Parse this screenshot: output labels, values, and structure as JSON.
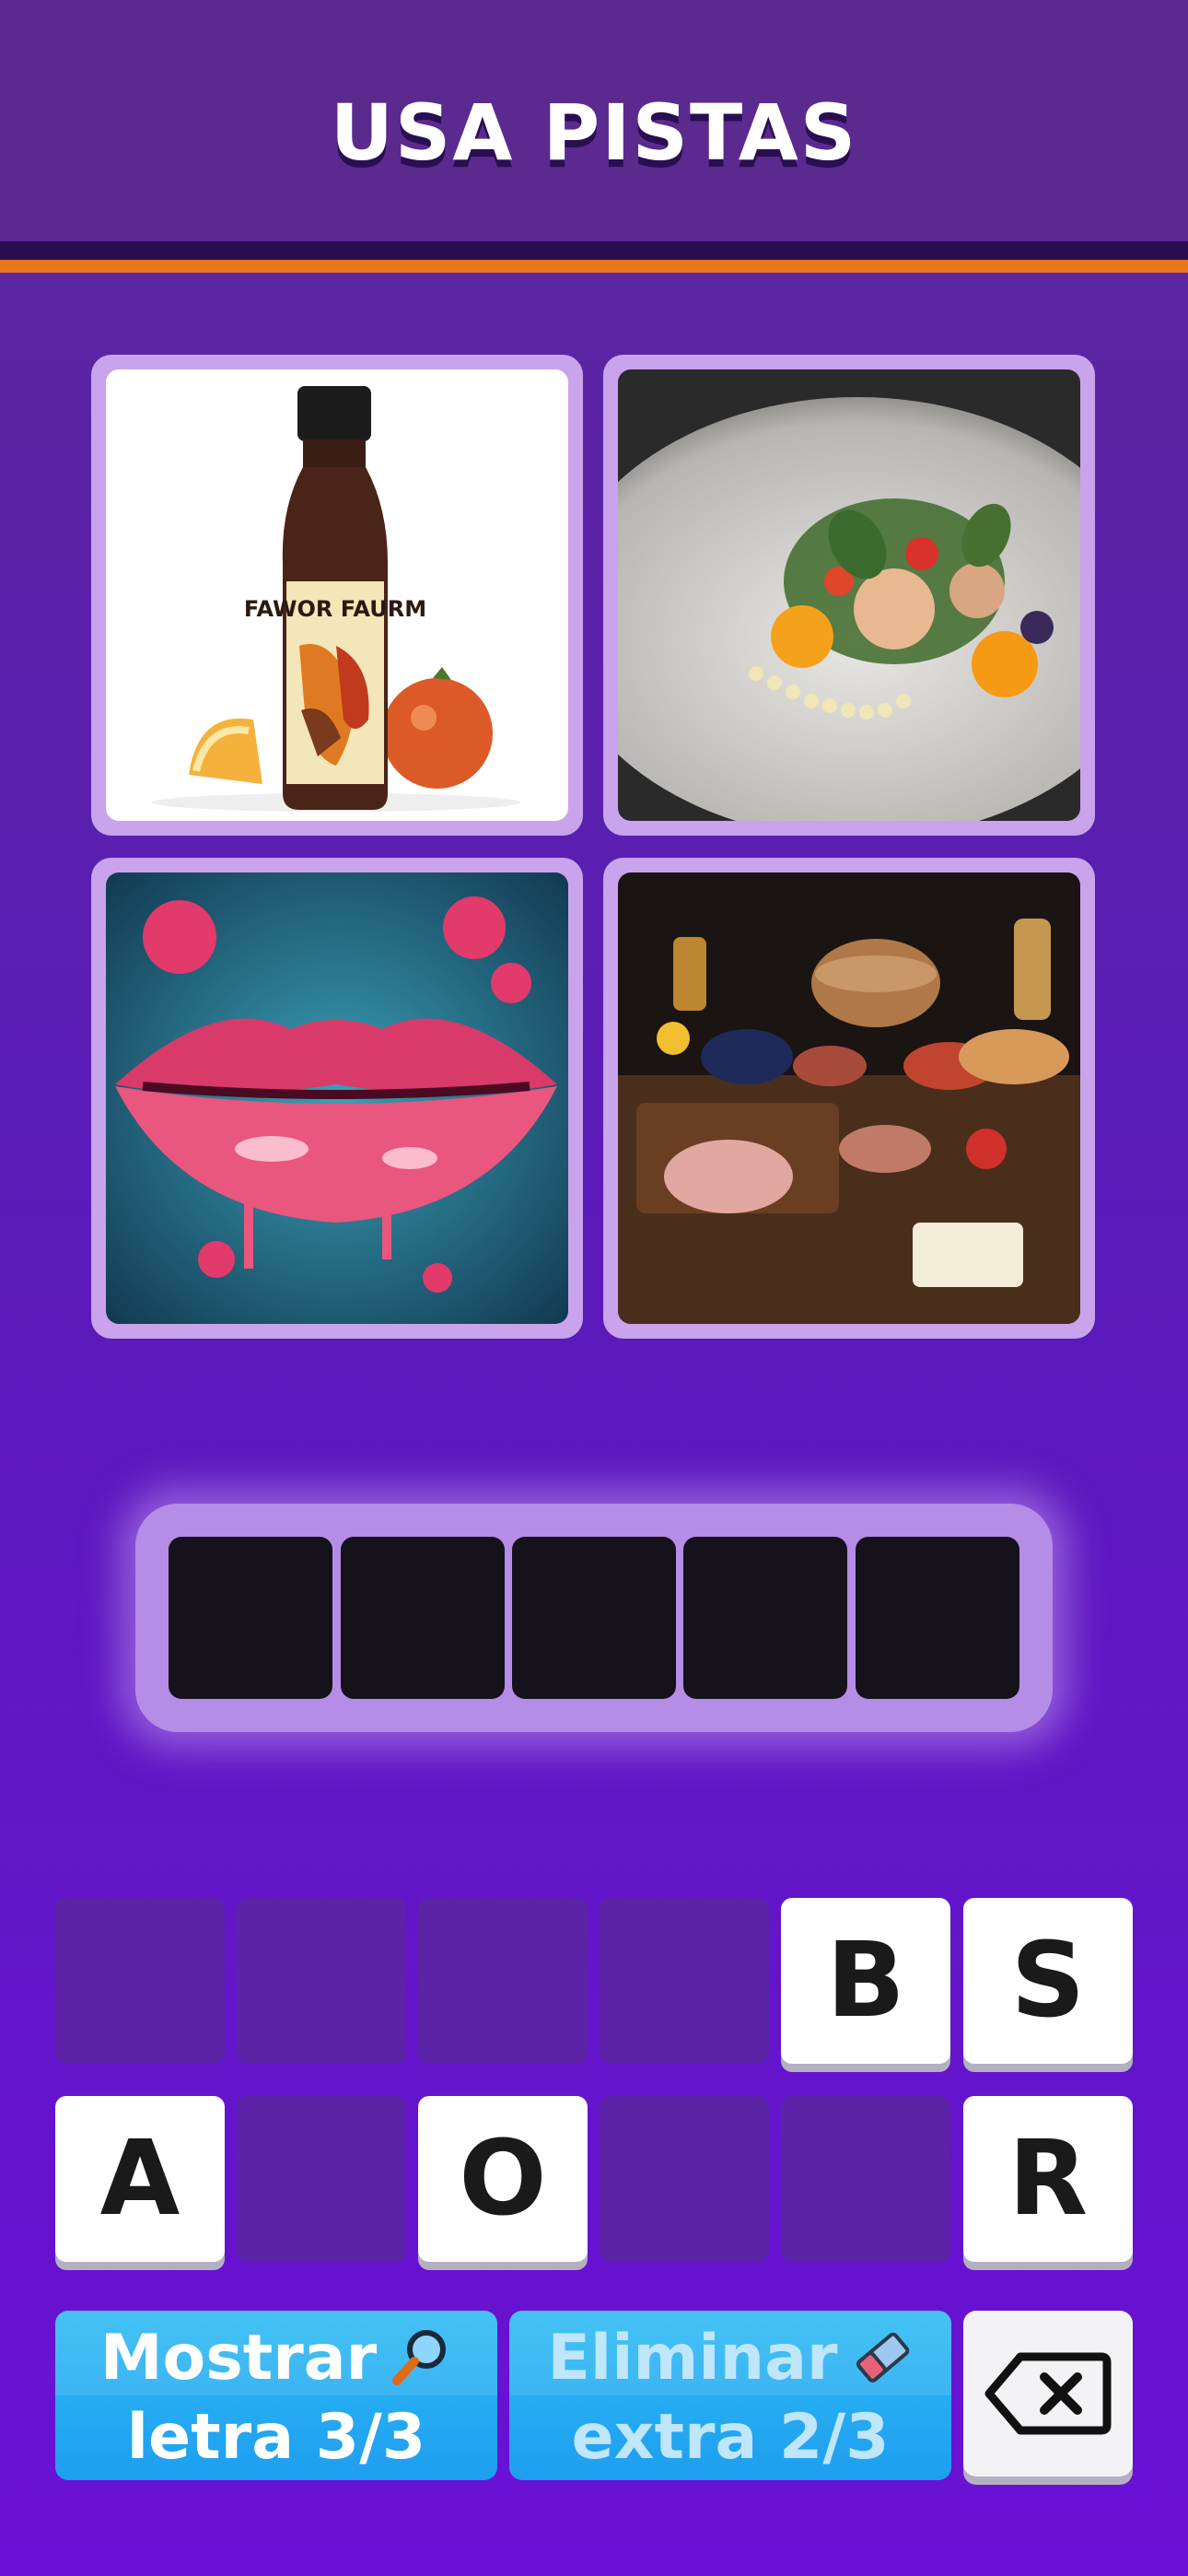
{
  "header": {
    "title": "USA PISTAS"
  },
  "images": [
    {
      "name": "sauce-bottle-image",
      "label": "FAWOR FAURM"
    },
    {
      "name": "gourmet-plate-image"
    },
    {
      "name": "lips-image"
    },
    {
      "name": "food-spread-image"
    }
  ],
  "answer": {
    "slots": [
      "",
      "",
      "",
      "",
      ""
    ]
  },
  "keyboard": {
    "row1": [
      "",
      "",
      "",
      "",
      "B",
      "S"
    ],
    "row2": [
      "A",
      "",
      "O",
      "",
      "",
      "R"
    ]
  },
  "hints": {
    "reveal": {
      "line1": "Mostrar",
      "line2": "letra 3/3",
      "icon": "magnifier-icon"
    },
    "remove": {
      "line1": "Eliminar",
      "line2": "extra 2/3",
      "icon": "eraser-icon"
    }
  },
  "backspace": {
    "icon": "backspace-icon"
  },
  "colors": {
    "background": "#5a1bb8",
    "header": "#5a2a8e",
    "accent_orange": "#e8761e",
    "tile_border": "#c9a3ec",
    "hint_button": "#1e9ef0"
  }
}
